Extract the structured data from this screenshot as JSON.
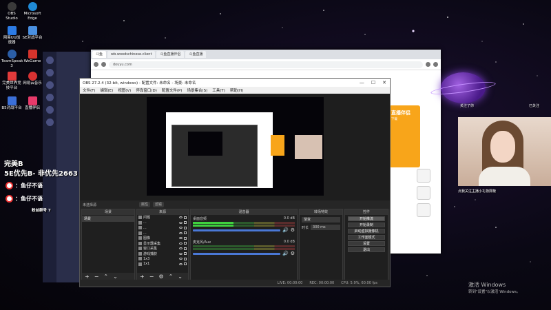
{
  "desktop": {
    "icons": [
      {
        "label": "OBS Studio",
        "color": "#3a3a3a"
      },
      {
        "label": "Microsoft Edge",
        "color": "#1f8ad6"
      },
      {
        "label": "网易UU加速器",
        "color": "#2c7be5"
      },
      {
        "label": "SE对战平台",
        "color": "#4a90e2"
      },
      {
        "label": "TeamSpeak 3",
        "color": "#2b5ea7"
      },
      {
        "label": "WeGame",
        "color": "#d6332c"
      },
      {
        "label": "完美世界竞技平台",
        "color": "#e23b3b"
      },
      {
        "label": "网易云音乐",
        "color": "#d83232"
      },
      {
        "label": "B5对战平台",
        "color": "#3b6fd8"
      },
      {
        "label": "直播伴侣",
        "color": "#e83a6a"
      }
    ]
  },
  "overlay": {
    "team": "完美B",
    "line2": "5E优先B- 非优先2663",
    "weibo1": "：鱼仔不语",
    "weibo2": "：鱼仔不语",
    "small": "粉丝群号 7"
  },
  "browser": {
    "tabs": [
      "斗鱼",
      "wb.woodschinese.client",
      "斗鱼直播伴侣",
      "斗鱼直播"
    ],
    "url": "douyu.com"
  },
  "orange": {
    "title": "直播伴侣",
    "sub": "下载"
  },
  "right_labels": {
    "top": "关注了你",
    "follow": "已关注"
  },
  "webcam": {
    "caption": "点我关注主播小礼物屏蔽"
  },
  "obs": {
    "title": "OBS 27.2.4 (32-bit, windows) - 配置文件: 未命名 - 场景: 未命名",
    "menu": [
      "文件(F)",
      "编辑(E)",
      "视图(V)",
      "停靠窗口(D)",
      "配置文件(P)",
      "场景集合(S)",
      "工具(T)",
      "帮助(H)"
    ],
    "source_bar": {
      "no_source": "未选择源",
      "props": "属性",
      "filters": "滤镜"
    },
    "scenes": {
      "title": "场景",
      "items": [
        "场景"
      ]
    },
    "sources": {
      "title": "来源",
      "items": [
        "问题",
        "...",
        "...",
        "...",
        "图像",
        "显示器采集",
        "窗口采集",
        "游戏捕获",
        "1x3",
        "1x1"
      ]
    },
    "mixer": {
      "title": "混音器",
      "rows": [
        {
          "label": "桌面音频",
          "db": "0.0 dB"
        },
        {
          "label": "麦克风/Aux",
          "db": "0.0 dB"
        }
      ]
    },
    "transitions": {
      "title": "转场特效",
      "selected": "渐变",
      "duration_label": "时长",
      "duration": "300 ms"
    },
    "controls": {
      "title": "控件",
      "buttons": [
        "开始推流",
        "开始录制",
        "启动虚拟摄像机",
        "工作室模式",
        "设置",
        "退出"
      ]
    },
    "status": {
      "live": "LIVE: 00:00:00",
      "rec": "REC: 00:00:00",
      "cpu": "CPU: 5.9%, 60.00 fps"
    }
  },
  "windows": {
    "activate1": "激活 Windows",
    "activate2": "转到\"设置\"以激活 Windows。"
  }
}
